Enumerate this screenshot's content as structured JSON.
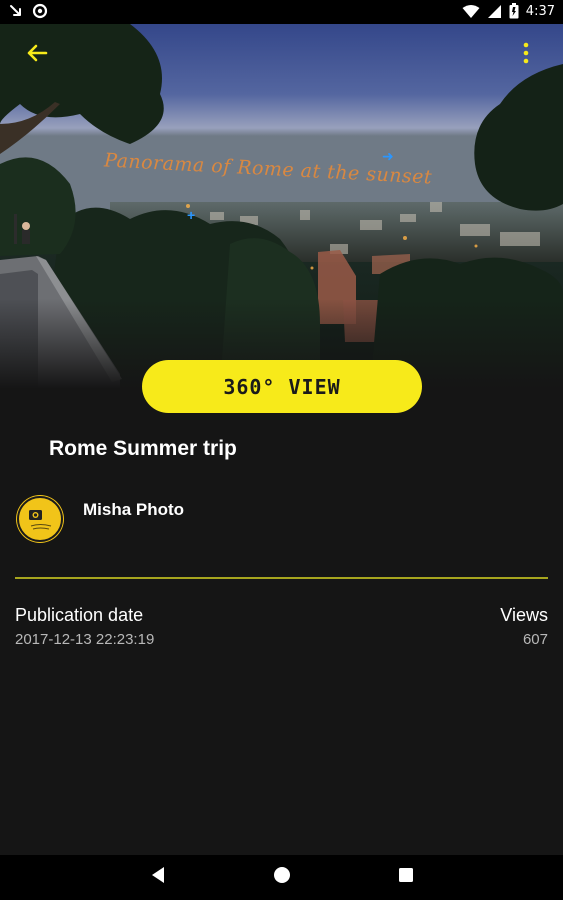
{
  "status_bar": {
    "time": "4:37",
    "icons": [
      "missed-call-icon",
      "circle-notification-icon",
      "wifi-icon",
      "signal-icon",
      "battery-icon"
    ]
  },
  "hero": {
    "panorama_title": "Panorama of Rome at the sunset"
  },
  "toolbar": {
    "back_icon": "arrow-back-icon",
    "menu_icon": "more-vert-icon",
    "accent_color": "#f7ea1a"
  },
  "view_button": {
    "label": "360° VIEW"
  },
  "trip": {
    "title": "Rome Summer trip"
  },
  "author": {
    "name": "Misha Photo",
    "avatar_icon": "author-avatar"
  },
  "details": {
    "publication_label": "Publication date",
    "publication_value": "2017-12-13 22:23:19",
    "views_label": "Views",
    "views_value": "607"
  },
  "nav_bar": {
    "icons": [
      "back-triangle-icon",
      "home-circle-icon",
      "recents-square-icon"
    ]
  },
  "colors": {
    "background": "#151515",
    "divider": "#a6a51e",
    "panorama_title": "#e58a3a"
  }
}
